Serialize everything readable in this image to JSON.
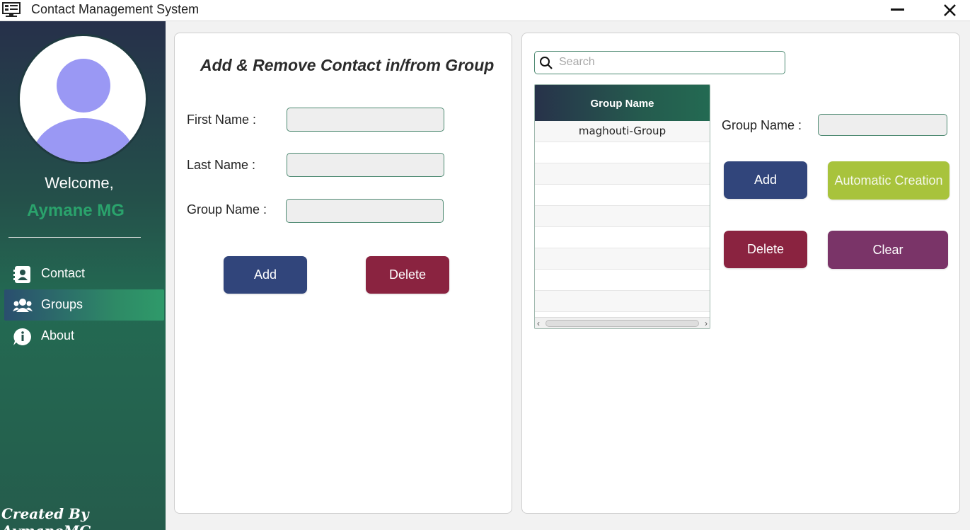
{
  "window": {
    "title": "Contact Management System"
  },
  "sidebar": {
    "welcome": "Welcome,",
    "username": "Aymane MG",
    "items": [
      {
        "label": "Contact",
        "icon": "contact-card-icon"
      },
      {
        "label": "Groups",
        "icon": "users-icon",
        "active": true
      },
      {
        "label": "About",
        "icon": "info-icon"
      }
    ],
    "footer": "Created By AymaneMG"
  },
  "left_panel": {
    "title": "Add & Remove Contact in/from Group",
    "first_name_label": "First Name :",
    "first_name_value": "",
    "last_name_label": "Last Name :",
    "last_name_value": "",
    "group_name_label": "Group Name :",
    "group_name_value": "",
    "add_label": "Add",
    "delete_label": "Delete"
  },
  "right_panel": {
    "search_placeholder": "Search",
    "table": {
      "header": "Group Name",
      "rows": [
        "maghouti-Group",
        "",
        "",
        "",
        "",
        "",
        "",
        "",
        ""
      ]
    },
    "group_name_label": "Group Name :",
    "group_name_value": "",
    "add_label": "Add",
    "automatic_label": "Automatic Creation",
    "delete_label": "Delete",
    "clear_label": "Clear"
  },
  "colors": {
    "add_button": "#31457b",
    "delete_button": "#8a2340",
    "automatic_button": "#a8c33c",
    "clear_button": "#7a3468",
    "username": "#2aa36c",
    "avatar": "#9a98f4"
  }
}
